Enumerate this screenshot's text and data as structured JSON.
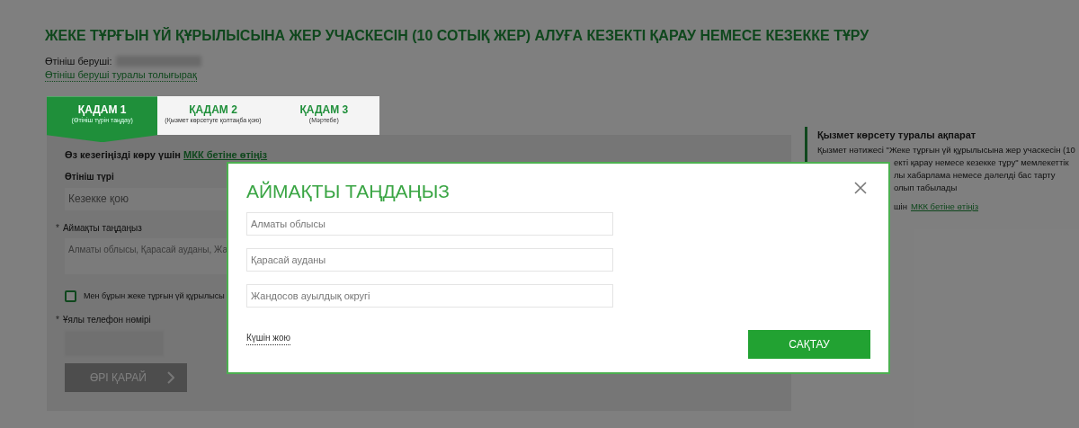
{
  "page_title": "ЖЕКЕ ТҰРҒЫН ҮЙ ҚҰРЫЛЫСЫНА ЖЕР УЧАСКЕСІН (10 СОТЫҚ ЖЕР) АЛУҒА КЕЗЕКТІ ҚАРАУ НЕМЕСЕ КЕЗЕККЕ ТҰРУ",
  "applicant": {
    "label": "Өтініш беруші:",
    "link": "Өтініш беруші туралы толығырақ"
  },
  "steps": [
    {
      "title": "ҚАДАМ 1",
      "subtitle": "(Өтініш түрін таңдау)",
      "selected": true
    },
    {
      "title": "ҚАДАМ 2",
      "subtitle": "(Қызмет көрсетуге қолтаңба қою)",
      "selected": false
    },
    {
      "title": "ҚАДАМ 3",
      "subtitle": "(Мәртебе)",
      "selected": false
    }
  ],
  "form": {
    "queue_note": {
      "text": "Өз кезегіңізді көру үшін",
      "link": "МКК бетіне өтіңіз"
    },
    "fields": [
      {
        "kind": "select",
        "label": "Өтініш түрі",
        "value": "Кезекке қою"
      },
      {
        "kind": "area",
        "mark": "*",
        "label": "Аймақты таңдаңыз",
        "value": "Алматы облысы, Қарасай ауданы, Жа"
      },
      {
        "kind": "checkbox",
        "label": "Мен бұрын жеке тұрғын үй құрылысы",
        "checked": false
      },
      {
        "kind": "phone",
        "mark": "*",
        "label": "Ұялы телефон нөмірі"
      }
    ],
    "next_button": {
      "label": "ӨРІ ҚАРАЙ",
      "disabled": true
    }
  },
  "sidebar": {
    "title": "Қызмет көрсету туралы ақпарат",
    "lines": [
      {
        "text": "Қызмет нәтижесі \"Жеке тұрғын үй құрылысына жер учаскесін (10",
        "cut": false
      },
      {
        "text": "екті қарау немесе кезекке тұру\" мемлекеттік",
        "cut": true
      },
      {
        "text": "лы хабарлама немесе дәлелді бас тарту",
        "cut": true
      },
      {
        "text": "олып табылады",
        "cut": true
      }
    ],
    "link_line": {
      "text": "шін",
      "link": "МКК бетіне өтіңіз",
      "cut": true
    }
  },
  "modal": {
    "title": "АЙМАҚТЫ ТАҢДАҢЫЗ",
    "selects": [
      {
        "value": "Алматы облысы"
      },
      {
        "value": "Қарасай ауданы"
      },
      {
        "value": "Жандосов ауылдық округі"
      }
    ],
    "cancel": "Күшін жою",
    "save": "САҚТАУ"
  }
}
